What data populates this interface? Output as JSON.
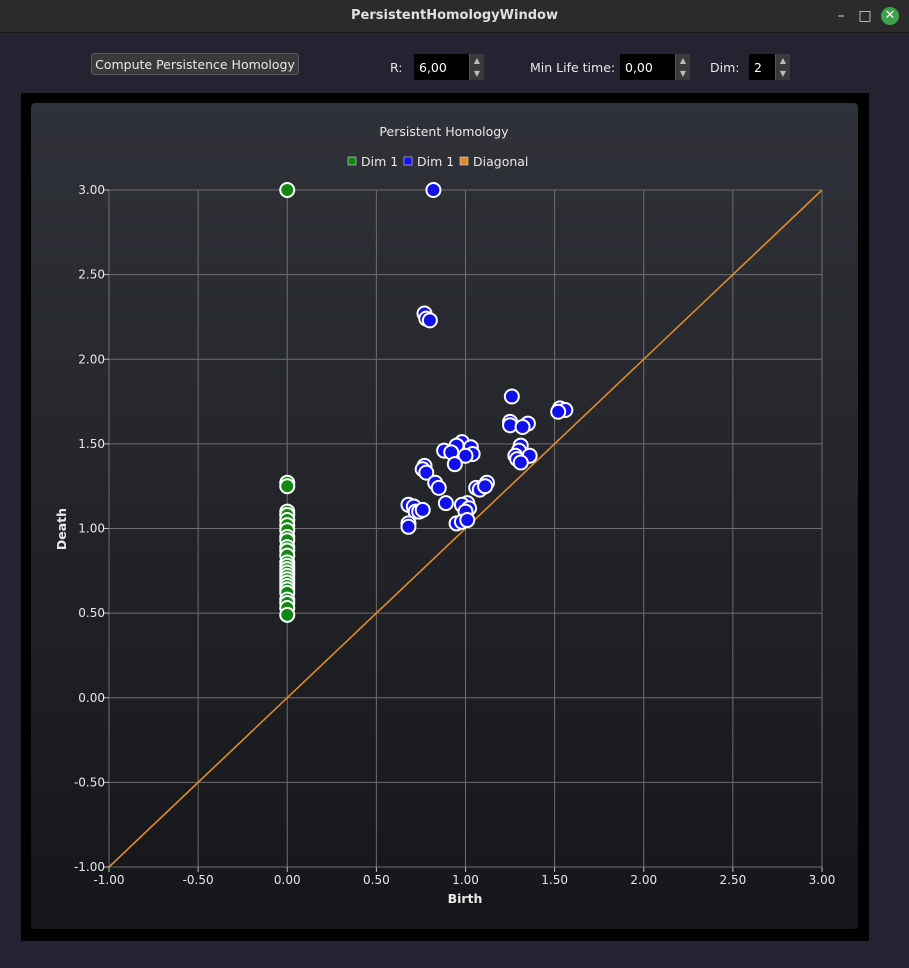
{
  "window": {
    "title": "PersistentHomologyWindow"
  },
  "toolbar": {
    "compute_label": "Compute Persistence Homology",
    "r_label": "R:",
    "r_value": "6,00",
    "lifetime_label": "Min Life time:",
    "lifetime_value": "0,00",
    "dim_label": "Dim:",
    "dim_value": "2"
  },
  "colors": {
    "dim0": "#118811",
    "dim1": "#1010e8",
    "diagonal": "#e08a2a",
    "grid": "#6e6e6e"
  },
  "chart_data": {
    "type": "scatter",
    "title": "Persistent Homology",
    "xlabel": "Birth",
    "ylabel": "Death",
    "xlim": [
      -1.0,
      3.0
    ],
    "ylim": [
      -1.0,
      3.0
    ],
    "xticks": [
      "-1.00",
      "-0.50",
      "0.00",
      "0.50",
      "1.00",
      "1.50",
      "2.00",
      "2.50",
      "3.00"
    ],
    "yticks": [
      "-1.00",
      "-0.50",
      "0.00",
      "0.50",
      "1.00",
      "1.50",
      "2.00",
      "2.50",
      "3.00"
    ],
    "grid": true,
    "legend_position": "top-center",
    "series": [
      {
        "name": "Dim 1",
        "color": "#118811",
        "points": [
          [
            0,
            3.0
          ],
          [
            0,
            1.27
          ],
          [
            0,
            1.25
          ],
          [
            0,
            1.1
          ],
          [
            0,
            1.08
          ],
          [
            0,
            1.05
          ],
          [
            0,
            1.02
          ],
          [
            0,
            0.99
          ],
          [
            0,
            0.95
          ],
          [
            0,
            0.93
          ],
          [
            0,
            0.89
          ],
          [
            0,
            0.87
          ],
          [
            0,
            0.84
          ],
          [
            0,
            0.8
          ],
          [
            0,
            0.78
          ],
          [
            0,
            0.76
          ],
          [
            0,
            0.74
          ],
          [
            0,
            0.72
          ],
          [
            0,
            0.7
          ],
          [
            0,
            0.68
          ],
          [
            0,
            0.66
          ],
          [
            0,
            0.64
          ],
          [
            0,
            0.62
          ],
          [
            0,
            0.58
          ],
          [
            0,
            0.56
          ],
          [
            0,
            0.53
          ],
          [
            0,
            0.49
          ]
        ]
      },
      {
        "name": "Dim 1",
        "color": "#1010e8",
        "points": [
          [
            0.82,
            3.0
          ],
          [
            0.77,
            2.27
          ],
          [
            0.78,
            2.24
          ],
          [
            0.8,
            2.23
          ],
          [
            1.26,
            1.78
          ],
          [
            1.53,
            1.71
          ],
          [
            1.56,
            1.7
          ],
          [
            1.52,
            1.69
          ],
          [
            1.25,
            1.63
          ],
          [
            1.25,
            1.61
          ],
          [
            1.35,
            1.62
          ],
          [
            1.32,
            1.6
          ],
          [
            0.98,
            1.51
          ],
          [
            0.95,
            1.49
          ],
          [
            1.03,
            1.48
          ],
          [
            0.88,
            1.46
          ],
          [
            0.92,
            1.45
          ],
          [
            1.04,
            1.44
          ],
          [
            1.0,
            1.43
          ],
          [
            0.94,
            1.38
          ],
          [
            1.31,
            1.49
          ],
          [
            1.3,
            1.46
          ],
          [
            1.28,
            1.43
          ],
          [
            1.36,
            1.43
          ],
          [
            1.29,
            1.41
          ],
          [
            1.31,
            1.39
          ],
          [
            0.77,
            1.37
          ],
          [
            0.76,
            1.35
          ],
          [
            0.78,
            1.33
          ],
          [
            0.83,
            1.27
          ],
          [
            0.85,
            1.24
          ],
          [
            1.06,
            1.24
          ],
          [
            1.12,
            1.27
          ],
          [
            1.08,
            1.23
          ],
          [
            1.11,
            1.25
          ],
          [
            0.68,
            1.14
          ],
          [
            0.71,
            1.13
          ],
          [
            0.72,
            1.1
          ],
          [
            0.74,
            1.1
          ],
          [
            0.76,
            1.11
          ],
          [
            0.89,
            1.15
          ],
          [
            1.01,
            1.15
          ],
          [
            0.98,
            1.14
          ],
          [
            1.02,
            1.12
          ],
          [
            1.0,
            1.1
          ],
          [
            0.68,
            1.03
          ],
          [
            0.68,
            1.01
          ],
          [
            0.95,
            1.03
          ],
          [
            0.98,
            1.04
          ],
          [
            1.01,
            1.05
          ]
        ]
      },
      {
        "name": "Diagonal",
        "color": "#e08a2a",
        "line": [
          [
            -1.0,
            -1.0
          ],
          [
            3.0,
            3.0
          ]
        ]
      }
    ]
  }
}
